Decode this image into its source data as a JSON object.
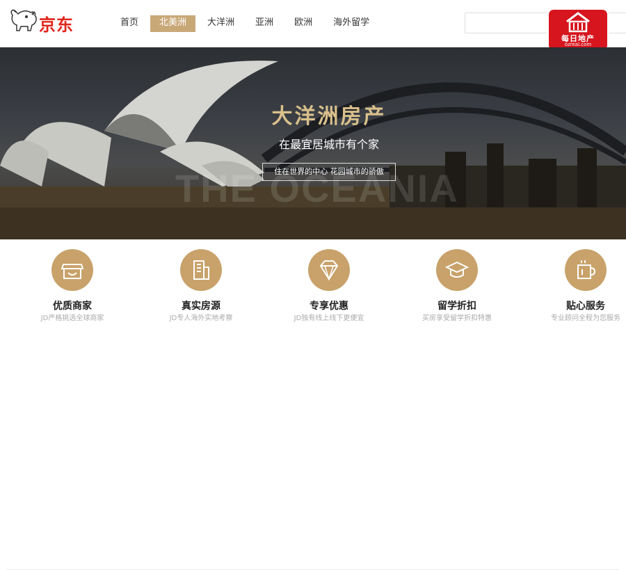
{
  "brand": {
    "name": "京东"
  },
  "nav": {
    "items": [
      "首页",
      "北美洲",
      "大洋洲",
      "亚洲",
      "欧洲",
      "海外留学"
    ],
    "active_index": 1
  },
  "search": {
    "placeholder": ""
  },
  "badge": {
    "title": "每日地产",
    "url": "ozreal.com",
    "color": "#d6151e"
  },
  "hero": {
    "title": "大洋洲房产",
    "background_text": "THE OCEANIA",
    "subtitle": "在最宜居城市有个家",
    "tagline": "住在世界的中心 花园城市的骄傲"
  },
  "features": [
    {
      "icon": "store-icon",
      "title": "优质商家",
      "desc": "JD严格挑选全球商家"
    },
    {
      "icon": "building-icon",
      "title": "真实房源",
      "desc": "JD专人海外实地考察"
    },
    {
      "icon": "diamond-icon",
      "title": "专享优惠",
      "desc": "JD独有线上线下更便宜"
    },
    {
      "icon": "graduation-cap-icon",
      "title": "留学折扣",
      "desc": "买房享受留学折扣特惠"
    },
    {
      "icon": "cup-icon",
      "title": "贴心服务",
      "desc": "专业顾问全程为您服务"
    }
  ],
  "colors": {
    "accent": "#c9a878",
    "brand_red": "#e1251b",
    "icon_gold": "#c8a26a"
  }
}
